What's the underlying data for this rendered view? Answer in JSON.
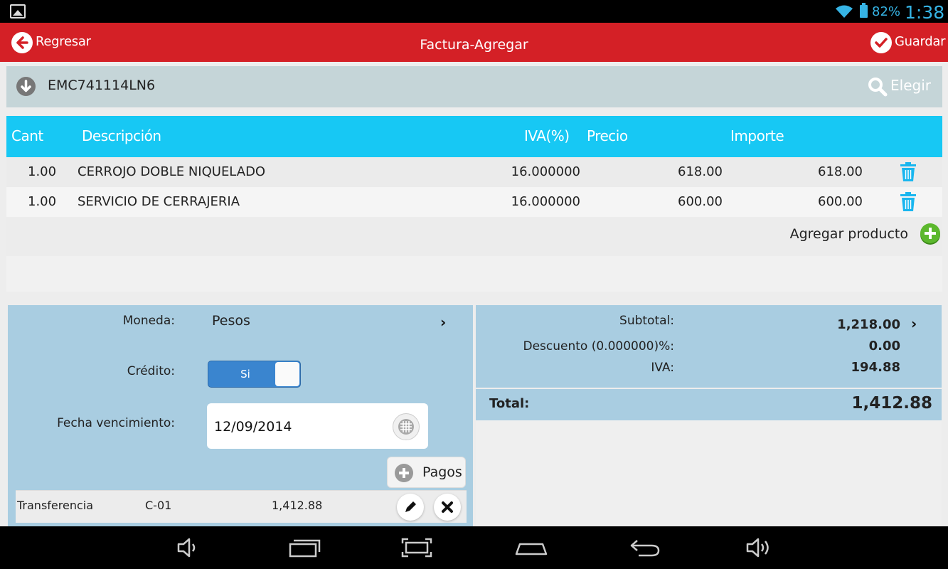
{
  "status_bar": {
    "battery": "82%",
    "time": "1:38"
  },
  "header": {
    "back_label": "Regresar",
    "title": "Factura-Agregar",
    "save_label": "Guardar"
  },
  "customer": {
    "rfc": "EMC741114LN6",
    "choose_label": "Elegir"
  },
  "table": {
    "columns": {
      "qty": "Cant",
      "description": "Descripción",
      "iva": "IVA(%)",
      "price": "Precio",
      "total": "Importe"
    },
    "rows": [
      {
        "qty": "1.00",
        "description": "CERROJO DOBLE NIQUELADO",
        "iva": "16.000000",
        "price": "618.00",
        "total": "618.00"
      },
      {
        "qty": "1.00",
        "description": "SERVICIO DE CERRAJERIA",
        "iva": "16.000000",
        "price": "600.00",
        "total": "600.00"
      }
    ],
    "add_product_label": "Agregar producto"
  },
  "form": {
    "currency_label": "Moneda:",
    "currency_value": "Pesos",
    "credit_label": "Crédito:",
    "credit_toggle": "Si",
    "due_date_label": "Fecha vencimiento:",
    "due_date_value": "12/09/2014",
    "payments_label": "Pagos",
    "payment": {
      "method": "Transferencia",
      "code": "C-01",
      "amount": "1,412.88"
    }
  },
  "totals": {
    "subtotal_label": "Subtotal:",
    "subtotal_value": "1,218.00",
    "discount_label": "Descuento (0.000000)%:",
    "discount_value": "0.00",
    "iva_label": "IVA:",
    "iva_value": "194.88",
    "total_label": "Total:",
    "total_value": "1,412.88"
  },
  "colors": {
    "header": "#d42026",
    "table_header": "#17c8f4",
    "panel": "#a9cde1",
    "accent": "#36b4e5"
  }
}
